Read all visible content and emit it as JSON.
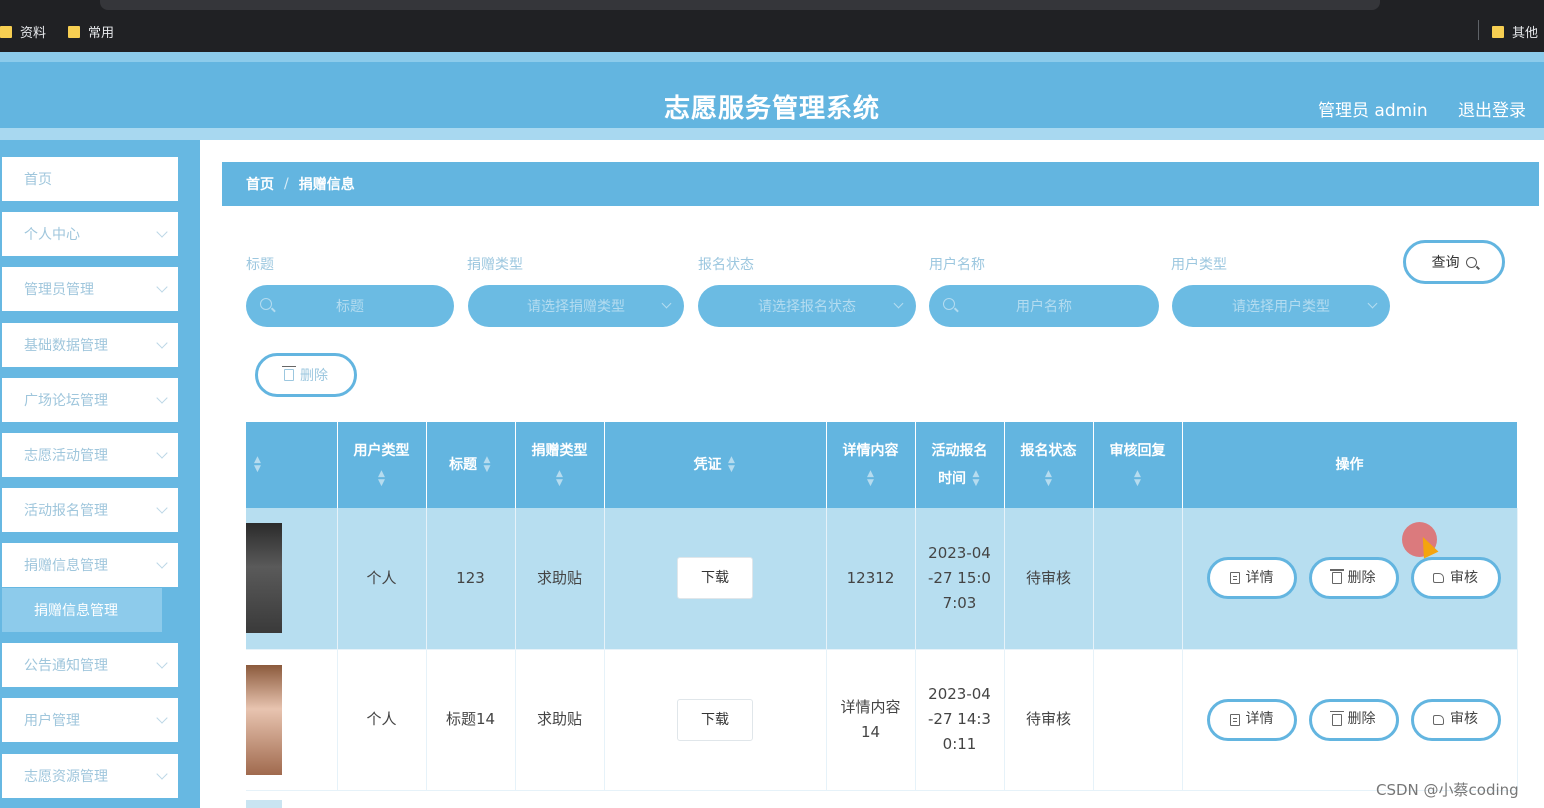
{
  "bookmarks": [
    "资料",
    "常用",
    "其他"
  ],
  "header": {
    "title": "志愿服务管理系统",
    "admin": "管理员 admin",
    "logout": "退出登录"
  },
  "sidebar": {
    "items": [
      {
        "label": "首页",
        "has_chevron": false
      },
      {
        "label": "个人中心",
        "has_chevron": true
      },
      {
        "label": "管理员管理",
        "has_chevron": true
      },
      {
        "label": "基础数据管理",
        "has_chevron": true
      },
      {
        "label": "广场论坛管理",
        "has_chevron": true
      },
      {
        "label": "志愿活动管理",
        "has_chevron": true
      },
      {
        "label": "活动报名管理",
        "has_chevron": true
      },
      {
        "label": "捐赠信息管理",
        "has_chevron": true,
        "expanded": true
      },
      {
        "label": "公告通知管理",
        "has_chevron": true
      },
      {
        "label": "用户管理",
        "has_chevron": true
      },
      {
        "label": "志愿资源管理",
        "has_chevron": true
      }
    ],
    "active_sub": "捐赠信息管理"
  },
  "breadcrumb": {
    "home": "首页",
    "sep": "/",
    "current": "捐赠信息"
  },
  "filters": {
    "title_label": "标题",
    "title_placeholder": "标题",
    "type_label": "捐赠类型",
    "type_placeholder": "请选择捐赠类型",
    "status_label": "报名状态",
    "status_placeholder": "请选择报名状态",
    "username_label": "用户名称",
    "username_placeholder": "用户名称",
    "usertype_label": "用户类型",
    "usertype_placeholder": "请选择用户类型",
    "query_button": "查询",
    "delete_button": "删除"
  },
  "table": {
    "headers": {
      "user_type": "用户类型",
      "title": "标题",
      "donation_type": "捐赠类型",
      "voucher": "凭证",
      "detail": "详情内容",
      "signup_time_1": "活动报名",
      "signup_time_2": "时间",
      "status": "报名状态",
      "review": "审核回复",
      "ops": "操作"
    },
    "rows": [
      {
        "user_type": "个人",
        "title": "123",
        "donation_type": "求助贴",
        "voucher": "下载",
        "detail": "12312",
        "time": "2023-04-27 15:07:03",
        "time_l1": "2023-04",
        "time_l2": "-27 15:0",
        "time_l3": "7:03",
        "status": "待审核",
        "review": ""
      },
      {
        "user_type": "个人",
        "title": "标题14",
        "donation_type": "求助贴",
        "voucher": "下载",
        "detail": "详情内容14",
        "detail_l1": "详情内容",
        "detail_l2": "14",
        "time": "2023-04-27 14:30:11",
        "time_l1": "2023-04",
        "time_l2": "-27 14:3",
        "time_l3": "0:11",
        "status": "待审核",
        "review": ""
      }
    ],
    "op_labels": {
      "detail": "详情",
      "delete": "删除",
      "review": "审核"
    }
  },
  "colors": {
    "primary": "#63b5e0",
    "light": "#8ccbeb",
    "row_highlight": "#b7def0"
  },
  "watermark": "CSDN @小蔡coding"
}
